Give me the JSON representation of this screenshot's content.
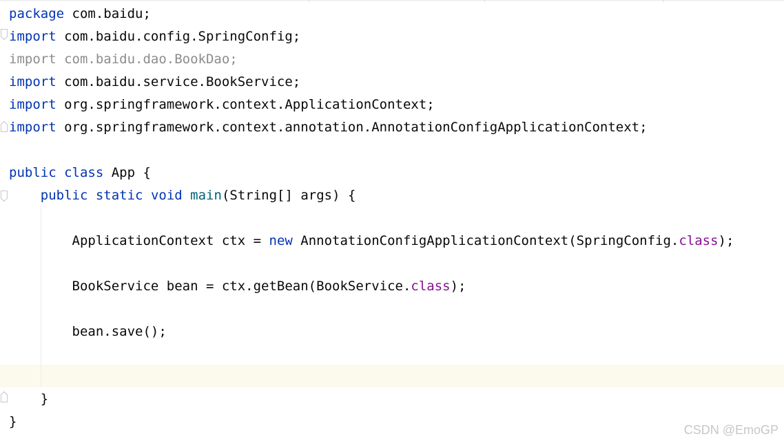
{
  "code": {
    "line1": {
      "kw": "package",
      "rest": " com.baidu;"
    },
    "line2": {
      "kw": "import",
      "rest": " com.baidu.config.SpringConfig;"
    },
    "line3": {
      "text": "import com.baidu.dao.BookDao;"
    },
    "line4": {
      "kw": "import",
      "rest": " com.baidu.service.BookService;"
    },
    "line5": {
      "kw": "import",
      "rest": " org.springframework.context.ApplicationContext;"
    },
    "line6": {
      "kw": "import",
      "rest": " org.springframework.context.annotation.AnnotationConfigApplicationContext;"
    },
    "line8": {
      "kw1": "public",
      "kw2": "class",
      "rest": " App {"
    },
    "line9": {
      "kw1": "public",
      "kw2": "static",
      "kw3": "void",
      "method": "main",
      "rest": "(String[] args) {"
    },
    "line11": {
      "pre": "ApplicationContext ctx = ",
      "kw": "new",
      "mid": " AnnotationConfigApplicationContext(SpringConfig.",
      "cls": "class",
      "post": ");"
    },
    "line13": {
      "pre": "BookService bean = ctx.getBean(BookService.",
      "cls": "class",
      "post": ");"
    },
    "line15": {
      "text": "bean.save();"
    },
    "line18": {
      "text": "}"
    },
    "line19": {
      "text": "}"
    }
  },
  "watermark": "CSDN @EmoGP",
  "colors": {
    "keyword": "#0033b3",
    "method": "#00627a",
    "class_keyword": "#871094",
    "unused_import": "#8c8c8c",
    "current_line": "#fcfaed"
  }
}
